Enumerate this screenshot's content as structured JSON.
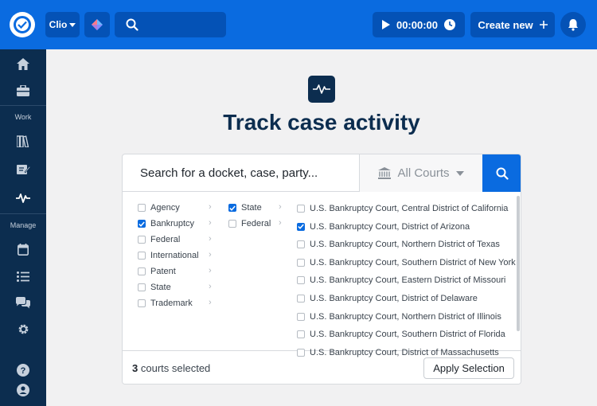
{
  "topbar": {
    "brand_label": "Clio",
    "timer": "00:00:00",
    "create_label": "Create new"
  },
  "sidebar": {
    "section_work": "Work",
    "section_manage": "Manage"
  },
  "main": {
    "title": "Track case activity",
    "search_placeholder": "Search for a docket, case, party...",
    "courts_label": "All Courts",
    "categories": [
      {
        "label": "Agency",
        "checked": false
      },
      {
        "label": "Bankruptcy",
        "checked": true
      },
      {
        "label": "Federal",
        "checked": false
      },
      {
        "label": "International",
        "checked": false
      },
      {
        "label": "Patent",
        "checked": false
      },
      {
        "label": "State",
        "checked": false
      },
      {
        "label": "Trademark",
        "checked": false
      }
    ],
    "levels": [
      {
        "label": "State",
        "checked": true
      },
      {
        "label": "Federal",
        "checked": false
      }
    ],
    "courts": [
      {
        "label": "U.S. Bankruptcy Court, Central District of California",
        "checked": false
      },
      {
        "label": "U.S. Bankruptcy Court, District of Arizona",
        "checked": true
      },
      {
        "label": "U.S. Bankruptcy Court, Northern District of Texas",
        "checked": false
      },
      {
        "label": "U.S. Bankruptcy Court, Southern District of New York",
        "checked": false
      },
      {
        "label": "U.S. Bankruptcy Court, Eastern District of Missouri",
        "checked": false
      },
      {
        "label": "U.S. Bankruptcy Court, District of Delaware",
        "checked": false
      },
      {
        "label": "U.S. Bankruptcy Court, Northern District of Illinois",
        "checked": false
      },
      {
        "label": "U.S. Bankruptcy Court, Southern District of Florida",
        "checked": false
      },
      {
        "label": "U.S. Bankruptcy Court, District of Massachusetts",
        "checked": false
      }
    ],
    "selected_count": "3",
    "selected_suffix": "courts selected",
    "apply_label": "Apply Selection"
  }
}
